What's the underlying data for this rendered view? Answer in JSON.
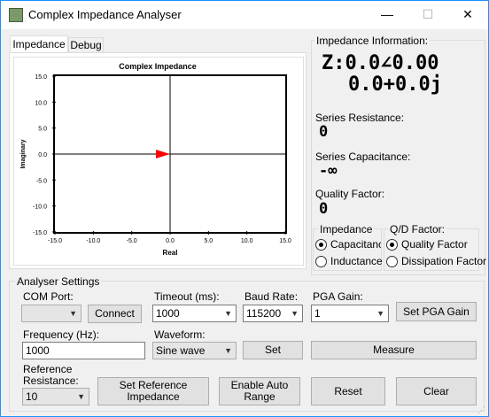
{
  "window": {
    "title": "Complex Impedance Analyser",
    "minimize": "—",
    "maximize": "☐",
    "close": "✕"
  },
  "tabs": [
    {
      "label": "Impedance"
    },
    {
      "label": "Debug"
    }
  ],
  "chart_data": {
    "type": "scatter",
    "title": "Complex Impedance",
    "xlabel": "Real",
    "ylabel": "Imaginary",
    "xlim": [
      -15.0,
      15.0
    ],
    "ylim": [
      -15.0,
      15.0
    ],
    "x_ticks": [
      "-15.0",
      "-10.0",
      "-5.0",
      "0.0",
      "5.0",
      "10.0",
      "15.0"
    ],
    "y_ticks": [
      "15.0",
      "10.0",
      "5.0",
      "0.0",
      "-5.0",
      "-10.0",
      "-15.0"
    ],
    "vector": {
      "x": 0.0,
      "y": 0.0,
      "color": "#ff0000"
    },
    "grid": false
  },
  "info": {
    "title": "Impedance Information:",
    "z_line1": "Z:0.0∠0.00",
    "z_line2": "0.0+0.0j",
    "series_resistance_label": "Series Resistance:",
    "series_resistance_value": "0",
    "series_capacitance_label": "Series Capacitance:",
    "series_capacitance_value": "-∞",
    "quality_factor_label": "Quality Factor:",
    "quality_factor_value": "0",
    "impedance_group": "Impedance",
    "capacitance": "Capacitanc",
    "inductance": "Inductance",
    "qd_group": "Q/D Factor:",
    "quality_factor_option": "Quality Factor",
    "dissipation_factor_option": "Dissipation Factor"
  },
  "settings": {
    "title": "Analyser Settings",
    "com_port_label": "COM Port:",
    "com_port_value": "",
    "connect": "Connect",
    "timeout_label": "Timeout (ms):",
    "timeout_value": "1000",
    "baud_label": "Baud Rate:",
    "baud_value": "115200",
    "pga_label": "PGA Gain:",
    "pga_value": "1",
    "set_pga": "Set PGA Gain",
    "frequency_label": "Frequency (Hz):",
    "frequency_value": "1000",
    "waveform_label": "Waveform:",
    "waveform_value": "Sine wave",
    "set": "Set",
    "measure": "Measure",
    "ref_label_1": "Reference",
    "ref_label_2": "Resistance:",
    "ref_value": "10",
    "set_reference_1": "Set Reference",
    "set_reference_2": "Impedance",
    "auto_range_1": "Enable Auto",
    "auto_range_2": "Range",
    "reset": "Reset",
    "clear": "Clear"
  }
}
